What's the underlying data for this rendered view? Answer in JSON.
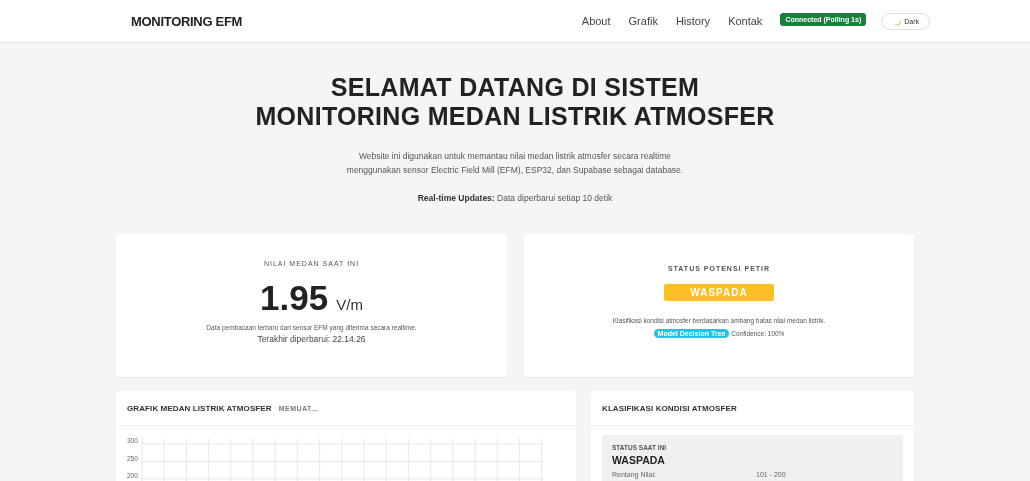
{
  "navbar": {
    "brand": "MONITORING EFM",
    "links": [
      {
        "label": "About"
      },
      {
        "label": "Grafik"
      },
      {
        "label": "History"
      },
      {
        "label": "Kontak"
      }
    ],
    "connection": {
      "label": "Connected (Polling 1s)",
      "connected": true
    },
    "theme_toggle": {
      "label": "Dark"
    }
  },
  "hero": {
    "title_lines": [
      "SELAMAT DATANG DI SISTEM",
      "MONITORING MEDAN LISTRIK ATMOSFER"
    ],
    "description_lines": [
      "Website ini digunakan untuk memantau nilai medan listrik atmosfer secara realtime",
      "menggunakan sensor Electric Field Mill (EFM), ESP32, dan Supabase sebagai database."
    ],
    "update_note": "**Real-time Updates:** Data diperbarui setiap 10 detik"
  },
  "value_card": {
    "heading": "NILAI MEDAN SAAT INI",
    "value": "1.95",
    "unit": "V/m",
    "description": "Data pembacaan terbaru dari sensor EFM yang diterima secara realtime.",
    "last_updated": "Terakhir diperbarui: 22.14.26"
  },
  "status_card": {
    "heading": "STATUS POTENSI PETIR",
    "status": "WASPADA",
    "color": "#fbbf24",
    "description": "Klasifikasi kondisi atmosfer berdasarkan ambang batas nilai medan listrik.",
    "model_badge": "Model Decision Tree",
    "confidence": "Confidence: 100%"
  },
  "chart_card": {
    "title": "GRAFIK MEDAN LISTRIK ATMOSFER",
    "loading": "MEMUAT...",
    "axis_labels": [
      "300",
      "250",
      "200"
    ]
  },
  "classification_card": {
    "title": "KLASIFIKASI KONDISI ATMOSFER",
    "current_label": "STATUS SAAT INI",
    "current_status": "WASPADA",
    "range_label": "Rentang Nilai:",
    "range_value": "101 - 200"
  }
}
